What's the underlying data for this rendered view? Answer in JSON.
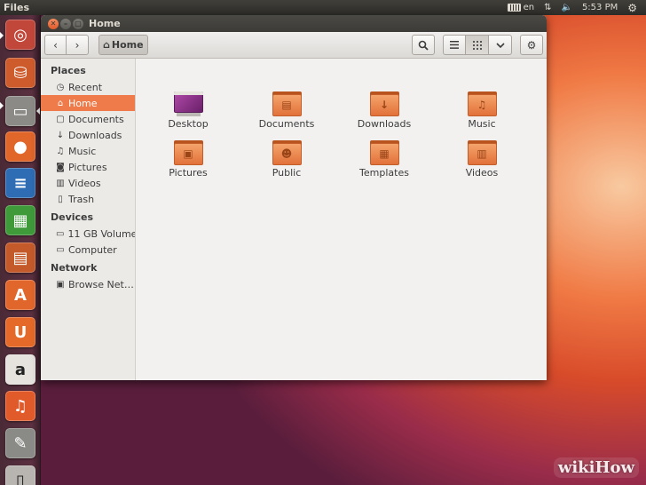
{
  "top_panel": {
    "title": "Files",
    "keyboard_layout": "en",
    "time": "5:53 PM"
  },
  "launcher": {
    "items": [
      {
        "icon": "dash-home-icon",
        "color": "#c1473a"
      },
      {
        "icon": "install-drive-icon",
        "color": "#cd5b2c"
      },
      {
        "icon": "files-icon",
        "color": "#8c8a86"
      },
      {
        "icon": "firefox-icon",
        "color": "#e0662a"
      },
      {
        "icon": "writer-icon",
        "color": "#2e6cb3"
      },
      {
        "icon": "calc-icon",
        "color": "#3f9a3a"
      },
      {
        "icon": "impress-icon",
        "color": "#c45a2a"
      },
      {
        "icon": "software-center-icon",
        "color": "#e1662c"
      },
      {
        "icon": "ubuntu-one-icon",
        "color": "#e56a2a"
      },
      {
        "icon": "amazon-icon",
        "color": "#e6e3de"
      },
      {
        "icon": "ubuntu-one-music-icon",
        "color": "#e15a2a"
      },
      {
        "icon": "system-settings-icon",
        "color": "#8a8a86"
      },
      {
        "icon": "trash-launcher-icon",
        "color": "#b8b5b0"
      }
    ]
  },
  "window": {
    "title": "Home",
    "toolbar": {
      "back_icon": "‹",
      "forward_icon": "›",
      "path_label": "Home"
    },
    "sidebar": {
      "sections": [
        {
          "heading": "Places",
          "items": [
            {
              "label": "Recent",
              "icon": "clock-icon"
            },
            {
              "label": "Home",
              "icon": "home-icon",
              "selected": true
            },
            {
              "label": "Documents",
              "icon": "document-icon"
            },
            {
              "label": "Downloads",
              "icon": "download-icon"
            },
            {
              "label": "Music",
              "icon": "music-icon"
            },
            {
              "label": "Pictures",
              "icon": "camera-icon"
            },
            {
              "label": "Videos",
              "icon": "film-icon"
            },
            {
              "label": "Trash",
              "icon": "trash-icon"
            }
          ]
        },
        {
          "heading": "Devices",
          "items": [
            {
              "label": "11 GB Volume",
              "icon": "drive-icon"
            },
            {
              "label": "Computer",
              "icon": "drive-icon"
            }
          ]
        },
        {
          "heading": "Network",
          "items": [
            {
              "label": "Browse Net…",
              "icon": "network-icon"
            }
          ]
        }
      ]
    },
    "files": [
      {
        "label": "Desktop",
        "type": "desktop"
      },
      {
        "label": "Documents",
        "type": "folder",
        "emblem": "documents"
      },
      {
        "label": "Downloads",
        "type": "folder",
        "emblem": "downloads"
      },
      {
        "label": "Music",
        "type": "folder",
        "emblem": "music"
      },
      {
        "label": "Pictures",
        "type": "folder",
        "emblem": "pictures"
      },
      {
        "label": "Public",
        "type": "folder",
        "emblem": "public"
      },
      {
        "label": "Templates",
        "type": "folder",
        "emblem": "templates"
      },
      {
        "label": "Videos",
        "type": "folder",
        "emblem": "videos"
      }
    ]
  },
  "watermark": "wikiHow"
}
